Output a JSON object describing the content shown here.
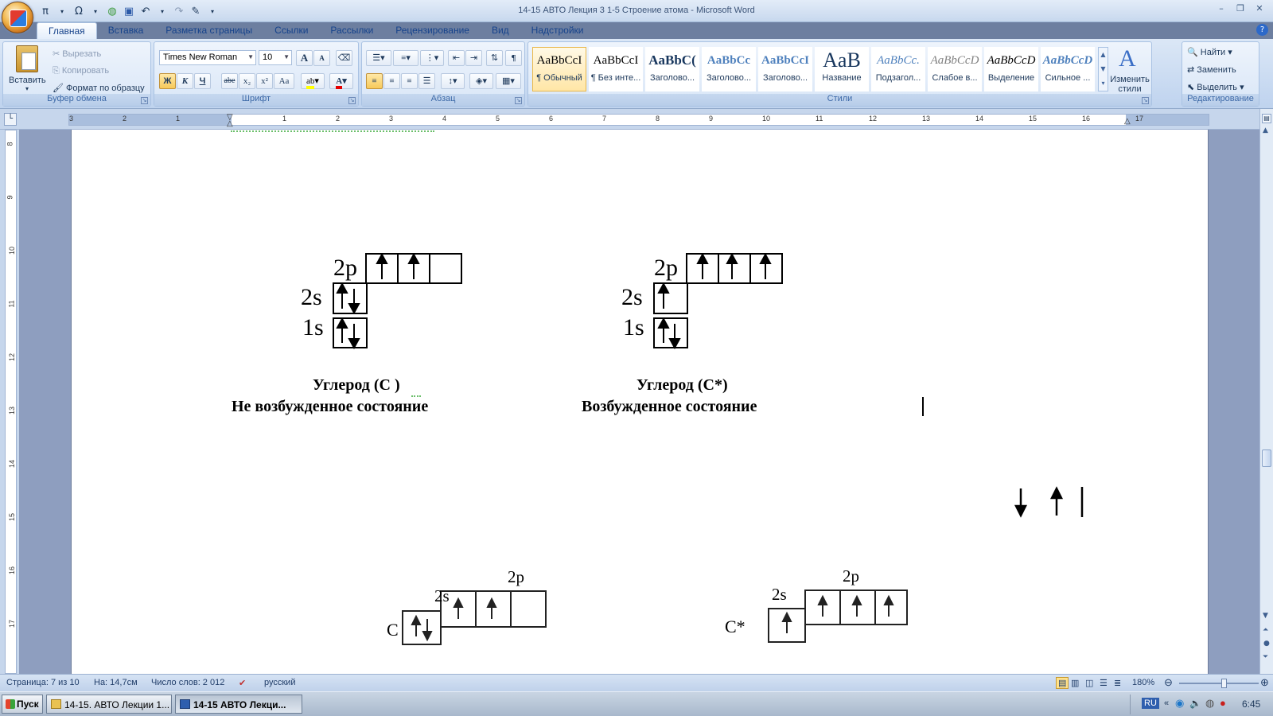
{
  "window": {
    "title": "14-15  АВТО Лекция 3  1-5  Строение  атома - Microsoft Word",
    "controls": [
      "–",
      "❐",
      "✕"
    ]
  },
  "qat": {
    "pi": "π",
    "omega": "Ω"
  },
  "tabs": [
    "Главная",
    "Вставка",
    "Разметка страницы",
    "Ссылки",
    "Рассылки",
    "Рецензирование",
    "Вид",
    "Надстройки"
  ],
  "ribbon": {
    "clipboard": {
      "label": "Буфер обмена",
      "paste": "Вставить",
      "cut": "Вырезать",
      "copy": "Копировать",
      "format_painter": "Формат по образцу"
    },
    "font": {
      "label": "Шрифт",
      "font_name": "Times New Roman",
      "font_size": "10",
      "bold": "Ж",
      "italic": "К",
      "underline": "Ч",
      "strike": "abe",
      "sub": "x₂",
      "sup": "x²",
      "case": "Aa",
      "grow": "A",
      "shrink": "A"
    },
    "paragraph": {
      "label": "Абзац",
      "pilcrow": "¶"
    },
    "styles": {
      "label": "Стили",
      "items": [
        {
          "sample": "AaBbCcI",
          "name": "¶ Обычный"
        },
        {
          "sample": "AaBbCcI",
          "name": "¶ Без инте..."
        },
        {
          "sample": "AaBbC(",
          "name": "Заголово..."
        },
        {
          "sample": "AaBbCc",
          "name": "Заголово..."
        },
        {
          "sample": "AaBbCcI",
          "name": "Заголово..."
        },
        {
          "sample": "AaB",
          "name": "Название"
        },
        {
          "sample": "AaBbCc.",
          "name": "Подзагол..."
        },
        {
          "sample": "AaBbCcD",
          "name": "Слабое в..."
        },
        {
          "sample": "AaBbCcD",
          "name": "Выделение"
        },
        {
          "sample": "AaBbCcD",
          "name": "Сильное ..."
        }
      ],
      "change_styles": "Изменить стили"
    },
    "editing": {
      "label": "Редактирование",
      "find": "Найти",
      "replace": "Заменить",
      "select": "Выделить"
    }
  },
  "ruler": {
    "h_marks": [
      "3",
      "2",
      "1",
      "1",
      "2",
      "3",
      "4",
      "5",
      "6",
      "7",
      "8",
      "9",
      "10",
      "11",
      "12",
      "13",
      "14",
      "15",
      "16",
      "17"
    ],
    "v_marks": [
      "8",
      "9",
      "10",
      "11",
      "12",
      "13",
      "14",
      "15",
      "16",
      "17"
    ]
  },
  "document": {
    "diagram1": {
      "lbl_2p": "2p",
      "lbl_2s": "2s",
      "lbl_1s": "1s",
      "caption_line1": "Углерод  (С )",
      "caption_line2": "Не возбужденное состояние"
    },
    "diagram2": {
      "lbl_2p": "2p",
      "lbl_2s": "2s",
      "lbl_1s": "1s",
      "caption_line1": "Углерод  (С*)",
      "caption_line2": "Возбужденное состояние"
    },
    "diagram3": {
      "lbl_2p": "2p",
      "lbl_2s": "2s",
      "atom": "С"
    },
    "diagram4": {
      "lbl_2p": "2p",
      "lbl_2s": "2s",
      "atom": "С*"
    }
  },
  "statusbar": {
    "page": "Страница: 7 из 10",
    "position": "На: 14,7см",
    "words": "Число слов: 2 012",
    "language": "русский",
    "zoom": "180%"
  },
  "taskbar": {
    "start": "Пуск",
    "tasks": [
      "14-15. АВТО  Лекции 1...",
      "14-15   АВТО  Лекци..."
    ],
    "lang": "RU",
    "clock": "6:45"
  }
}
